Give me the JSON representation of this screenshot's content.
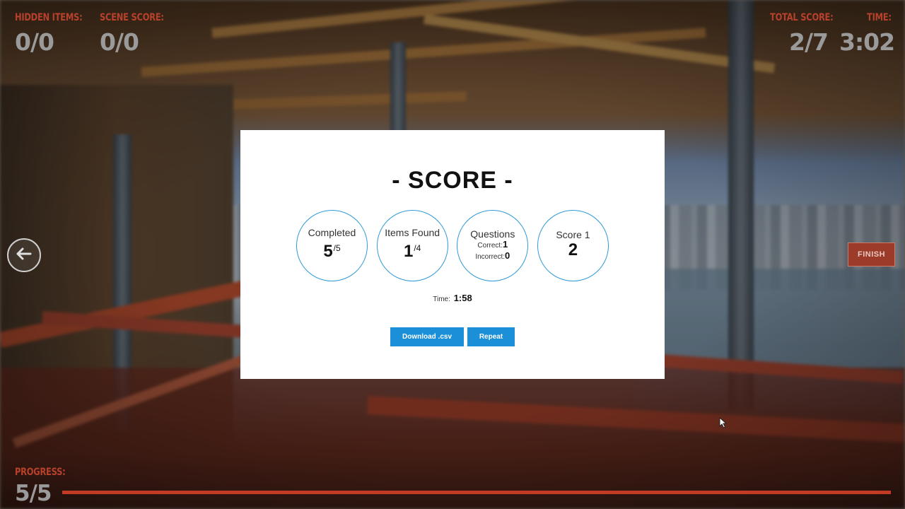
{
  "hud": {
    "hidden_items_label": "HIDDEN ITEMS:",
    "hidden_items_value": "0/0",
    "scene_score_label": "SCENE SCORE:",
    "scene_score_value": "0/0",
    "total_score_label": "TOTAL SCORE:",
    "total_score_value": "2/7",
    "time_label": "TIME:",
    "time_value": "3:02",
    "progress_label": "PROGRESS:",
    "progress_value": "5/5",
    "progress_fraction": 1.0,
    "finish_label": "FINISH",
    "back_icon": "arrow-left-icon"
  },
  "modal": {
    "title": "- SCORE -",
    "completed": {
      "label": "Completed",
      "value": "5",
      "total": "/5"
    },
    "items_found": {
      "label": "Items Found",
      "value": "1",
      "total": "/4"
    },
    "questions": {
      "label": "Questions",
      "correct_label": "Correct:",
      "correct_value": "1",
      "incorrect_label": "Incorrect:",
      "incorrect_value": "0"
    },
    "score": {
      "label": "Score 1",
      "value": "2"
    },
    "time_label": "Time:",
    "time_value": "1:58",
    "download_label": "Download .csv",
    "repeat_label": "Repeat"
  },
  "colors": {
    "accent_blue": "#1b8fd8",
    "circle_border": "#2f9ad8",
    "hud_red": "#b8412c",
    "hud_grey": "#9a9a9a"
  }
}
